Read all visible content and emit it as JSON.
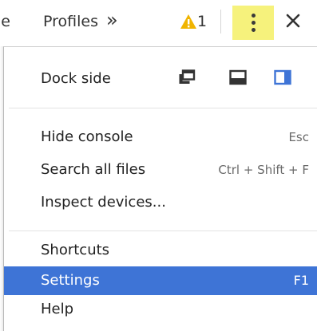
{
  "toolbar": {
    "partial_tab": "ie",
    "profiles_tab": "Profiles",
    "more_tabs": "»",
    "warning_count": "1",
    "colors": {
      "warning": "#f0b400",
      "kebab_highlight": "#f6f27c"
    },
    "icons": {
      "warning": "warning-icon",
      "menu": "kebab-menu-icon",
      "close": "close-icon"
    }
  },
  "menu": {
    "dock_side": {
      "label": "Dock side",
      "options": [
        {
          "icon": "undock-into-separate-window-icon",
          "selected": false
        },
        {
          "icon": "dock-to-bottom-icon",
          "selected": false
        },
        {
          "icon": "dock-to-right-icon",
          "selected": true
        }
      ],
      "selected_color": "#3e74d6"
    },
    "items": [
      {
        "label": "Hide console",
        "shortcut": "Esc"
      },
      {
        "label": "Search all files",
        "shortcut": "Ctrl + Shift + F"
      },
      {
        "label": "Inspect devices...",
        "shortcut": ""
      },
      {
        "label": "Shortcuts",
        "shortcut": ""
      },
      {
        "label": "Settings",
        "shortcut": "F1",
        "selected": true
      },
      {
        "label": "Help",
        "shortcut": ""
      }
    ],
    "selected_color": "#3e74d6"
  }
}
